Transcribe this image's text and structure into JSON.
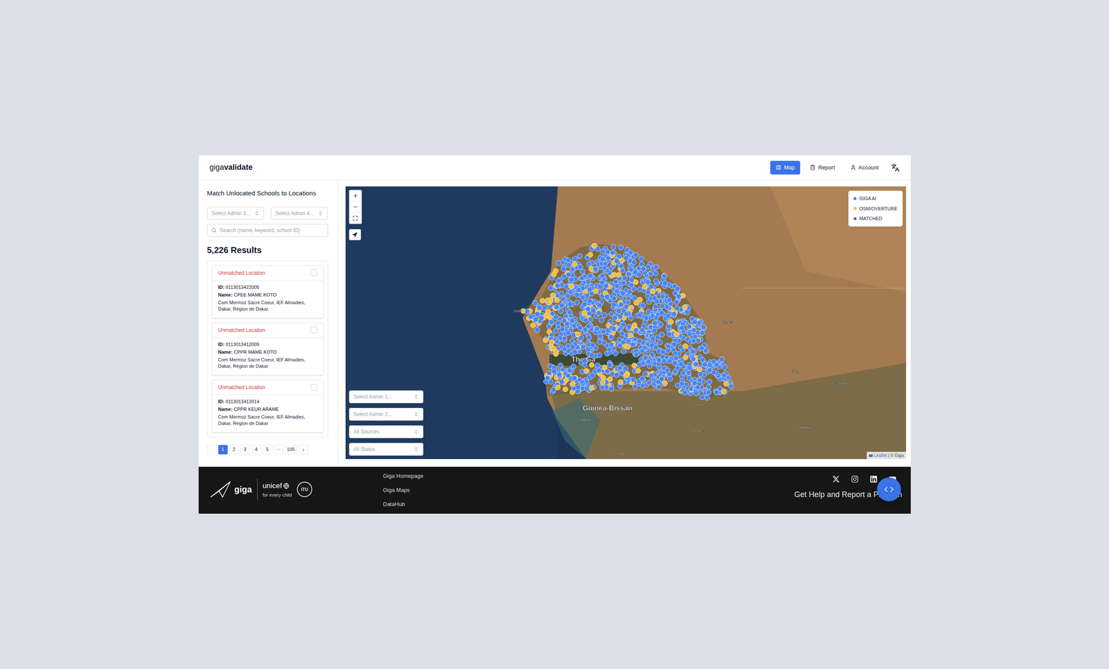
{
  "app": {
    "logo_light": "giga",
    "logo_bold": "validate"
  },
  "nav": [
    {
      "label": "Map",
      "selected": true
    },
    {
      "label": "Report",
      "selected": false
    },
    {
      "label": "Account",
      "selected": false
    }
  ],
  "sidebar": {
    "title": "Match Unlocated Schools to Locations",
    "filters": [
      "Select Admin 3...",
      "Select Admin 4..."
    ],
    "search": {
      "placeholder": "Search (name, keyword, school ID)"
    },
    "results": "5,226 Results",
    "cards": [
      {
        "status": "Unmatched Location",
        "checked": false,
        "id_label": "ID:",
        "id": "0113013422005",
        "name_label": "Name:",
        "name": "CPEE MAME KOTO",
        "address": "Com Mermoz Sacre Coeur, IEF Almadies, Dakar, Région de Dakar"
      },
      {
        "status": "Unmatched Location",
        "checked": false,
        "id_label": "ID:",
        "id": "0113013412009",
        "name_label": "Name:",
        "name": "CPPR MAME KOTO",
        "address": "Com Mermoz Sacre Coeur, IEF Almadies, Dakar, Région de Dakar"
      },
      {
        "status": "Unmatched Location",
        "checked": false,
        "id_label": "ID:",
        "id": "0113013412014",
        "name_label": "Name:",
        "name": "CPPR KEUR ARAME",
        "address": "Com Mermoz Sacre Coeur, IEF Almadies, Dakar, Région de Dakar"
      }
    ],
    "pagination": {
      "prev": {
        "label": "‹",
        "disabled": true
      },
      "pages": [
        {
          "label": "1",
          "selected": true
        },
        {
          "label": "2",
          "selected": false
        },
        {
          "label": "3",
          "selected": false
        },
        {
          "label": "4",
          "selected": false
        },
        {
          "label": "5",
          "selected": false
        },
        {
          "label": "···",
          "selected": false
        },
        {
          "label": "105",
          "selected": false
        }
      ],
      "next": {
        "label": "›",
        "disabled": false
      }
    }
  },
  "map": {
    "legend": [
      {
        "label": "GIGA AI",
        "color": "#4a86f0"
      },
      {
        "label": "OSM/OVERTURE",
        "color": "#f0bd3a"
      },
      {
        "label": "MATCHED",
        "color": "#6b7280"
      }
    ],
    "labels": [
      {
        "text": "Dak",
        "major": false
      },
      {
        "text": "The Ga",
        "major": true
      },
      {
        "text": "Guinea-Bissau",
        "major": true
      },
      {
        "text": "Bissau",
        "major": false
      },
      {
        "text": "Bamako",
        "major": false
      },
      {
        "text": "Kayes",
        "major": false
      },
      {
        "text": "Kita",
        "major": false
      },
      {
        "text": "Mali",
        "major": false
      },
      {
        "text": "Labe",
        "major": false
      },
      {
        "text": "Kamsar",
        "major": false
      },
      {
        "text": "Siguiri",
        "major": false
      }
    ],
    "filters": [
      "Select Admin 1...",
      "Select Admin 2...",
      "All Sources",
      "All Status"
    ],
    "attribution_leaflet": "Leaflet",
    "attribution": "| © Giga"
  },
  "footer": {
    "logo": "giga",
    "unicef": "unicef",
    "tagline": "for every child",
    "itu": "ITU",
    "links": [
      "Giga Homepage",
      "Giga Maps",
      "DataHub"
    ],
    "help": "Get Help and Report a Problem"
  }
}
